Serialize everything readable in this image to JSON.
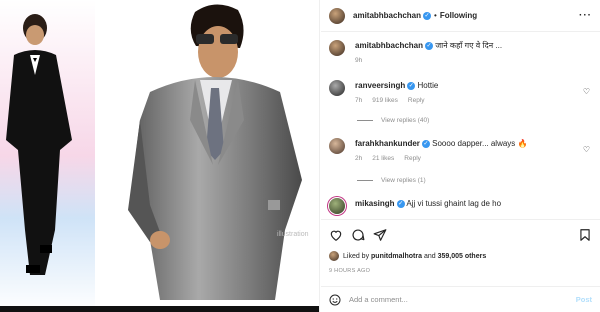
{
  "post": {
    "author": "amitabhbachchan",
    "follow_state": "Following",
    "separator": "•",
    "more_icon": "more-horizontal-icon",
    "media_watermark": "illustration"
  },
  "caption": {
    "username": "amitabhbachchan",
    "text": "जाने कहाँ गए वे दिन ...",
    "time": "9h"
  },
  "comments": [
    {
      "username": "ranveersingh",
      "verified": true,
      "text": "Hottie",
      "time": "7h",
      "likes": "919 likes",
      "reply": "Reply",
      "view_replies": "View replies (40)"
    },
    {
      "username": "farahkhankunder",
      "verified": true,
      "text": "Soooo dapper... always 🔥",
      "time": "2h",
      "likes": "21 likes",
      "reply": "Reply",
      "view_replies": "View replies (1)"
    },
    {
      "username": "mikasingh",
      "verified": true,
      "text": "Ajj vi tussi ghaint lag de ho"
    }
  ],
  "liked_by": {
    "prefix": "Liked by ",
    "user": "punitdmalhotra",
    "middle": " and ",
    "count": "359,005 others"
  },
  "timestamp": "9 HOURS AGO",
  "composer": {
    "placeholder": "Add a comment...",
    "post_label": "Post"
  },
  "colors": {
    "verified": "#3897f0",
    "muted": "#8e8e8e",
    "post_disabled": "#b2dffc"
  }
}
